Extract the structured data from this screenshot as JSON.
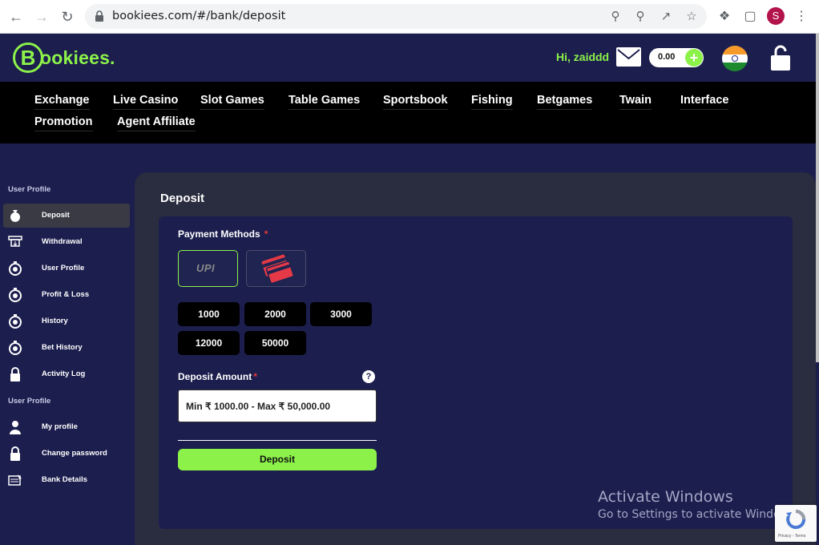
{
  "browser": {
    "url": "bookiees.com/#/bank/deposit",
    "profile_initial": "S"
  },
  "header": {
    "logo_letter": "B",
    "logo_word": "ookiees.",
    "greeting": "Hi, zaiddd",
    "balance": "0.00",
    "balance_add_symbol": "+"
  },
  "nav": {
    "items": [
      "Exchange",
      "Live Casino",
      "Slot Games",
      "Table Games",
      "Sportsbook",
      "Fishing",
      "Betgames",
      "Twain",
      "Interface",
      "Promotion",
      "Agent Affiliate"
    ]
  },
  "sidebar": {
    "section1": "User Profile",
    "section2": "User Profile",
    "items": [
      {
        "label": "Deposit",
        "icon": "money-bag-icon",
        "active": true
      },
      {
        "label": "Withdrawal",
        "icon": "withdraw-icon"
      },
      {
        "label": "User Profile",
        "icon": "timer-icon"
      },
      {
        "label": "Profit & Loss",
        "icon": "timer-icon"
      },
      {
        "label": "History",
        "icon": "timer-icon"
      },
      {
        "label": "Bet History",
        "icon": "timer-icon"
      },
      {
        "label": "Activity Log",
        "icon": "lock-icon"
      },
      {
        "label": "My profile",
        "icon": "user-icon"
      },
      {
        "label": "Change password",
        "icon": "lock-icon"
      },
      {
        "label": "Bank Details",
        "icon": "bank-icon"
      }
    ]
  },
  "deposit": {
    "title": "Deposit",
    "payment_methods_label": "Payment Methods",
    "required_mark": "*",
    "upi_label": "UPI",
    "amounts": [
      "1000",
      "2000",
      "3000",
      "12000",
      "50000"
    ],
    "amount_label": "Deposit Amount",
    "help_symbol": "?",
    "amount_placeholder": "Min ₹ 1000.00 - Max ₹ 50,000.00",
    "submit_label": "Deposit"
  },
  "watermark": {
    "line1": "Activate Windows",
    "line2": "Go to Settings to activate Windows."
  },
  "recaptcha": {
    "text": "Privacy - Terms"
  },
  "colors": {
    "accent": "#8cf24a",
    "background": "#1c1e4e",
    "panel": "#2a2d3f",
    "nav": "#000000",
    "required": "#e53935"
  }
}
